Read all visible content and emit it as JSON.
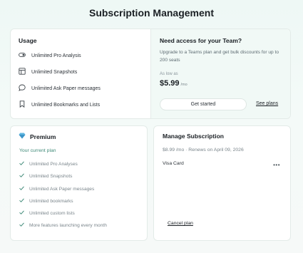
{
  "page": {
    "title": "Subscription Management"
  },
  "usage": {
    "heading": "Usage",
    "items": [
      {
        "label": "Unlimited Pro Analysis",
        "icon": "toggle-icon"
      },
      {
        "label": "Unlimited Snapshots",
        "icon": "grid-icon"
      },
      {
        "label": "Unlimited Ask Paper messages",
        "icon": "chat-bubble-icon"
      },
      {
        "label": "Unlimited Bookmarks and Lists",
        "icon": "bookmark-icon"
      }
    ]
  },
  "team": {
    "title": "Need access for your Team?",
    "description": "Upgrade to a Teams plan and get bulk discounts for up to 200 seats",
    "as_low_as": "As low as",
    "price": "$5.99",
    "price_unit": "/mo",
    "cta": "Get started",
    "link": "See plans"
  },
  "premium": {
    "title": "Premium",
    "icon": "diamond-icon",
    "current_plan": "Your current plan",
    "features": [
      "Unlimited Pro Analyses",
      "Unlimited Snapshots",
      "Unlimited Ask Paper messages",
      "Unlimited bookmarks",
      "Unlimited custom lists",
      "More features launching every month"
    ]
  },
  "manage": {
    "title": "Manage Subscription",
    "renewal": "$8.99 /mo · Renews on April 09, 2026",
    "payment": "Visa Card",
    "more": "•••",
    "cancel": "Cancel plan"
  },
  "colors": {
    "accent": "#3f8a78",
    "background": "#eef8f5",
    "premium_icon": "#4aa8d8"
  }
}
